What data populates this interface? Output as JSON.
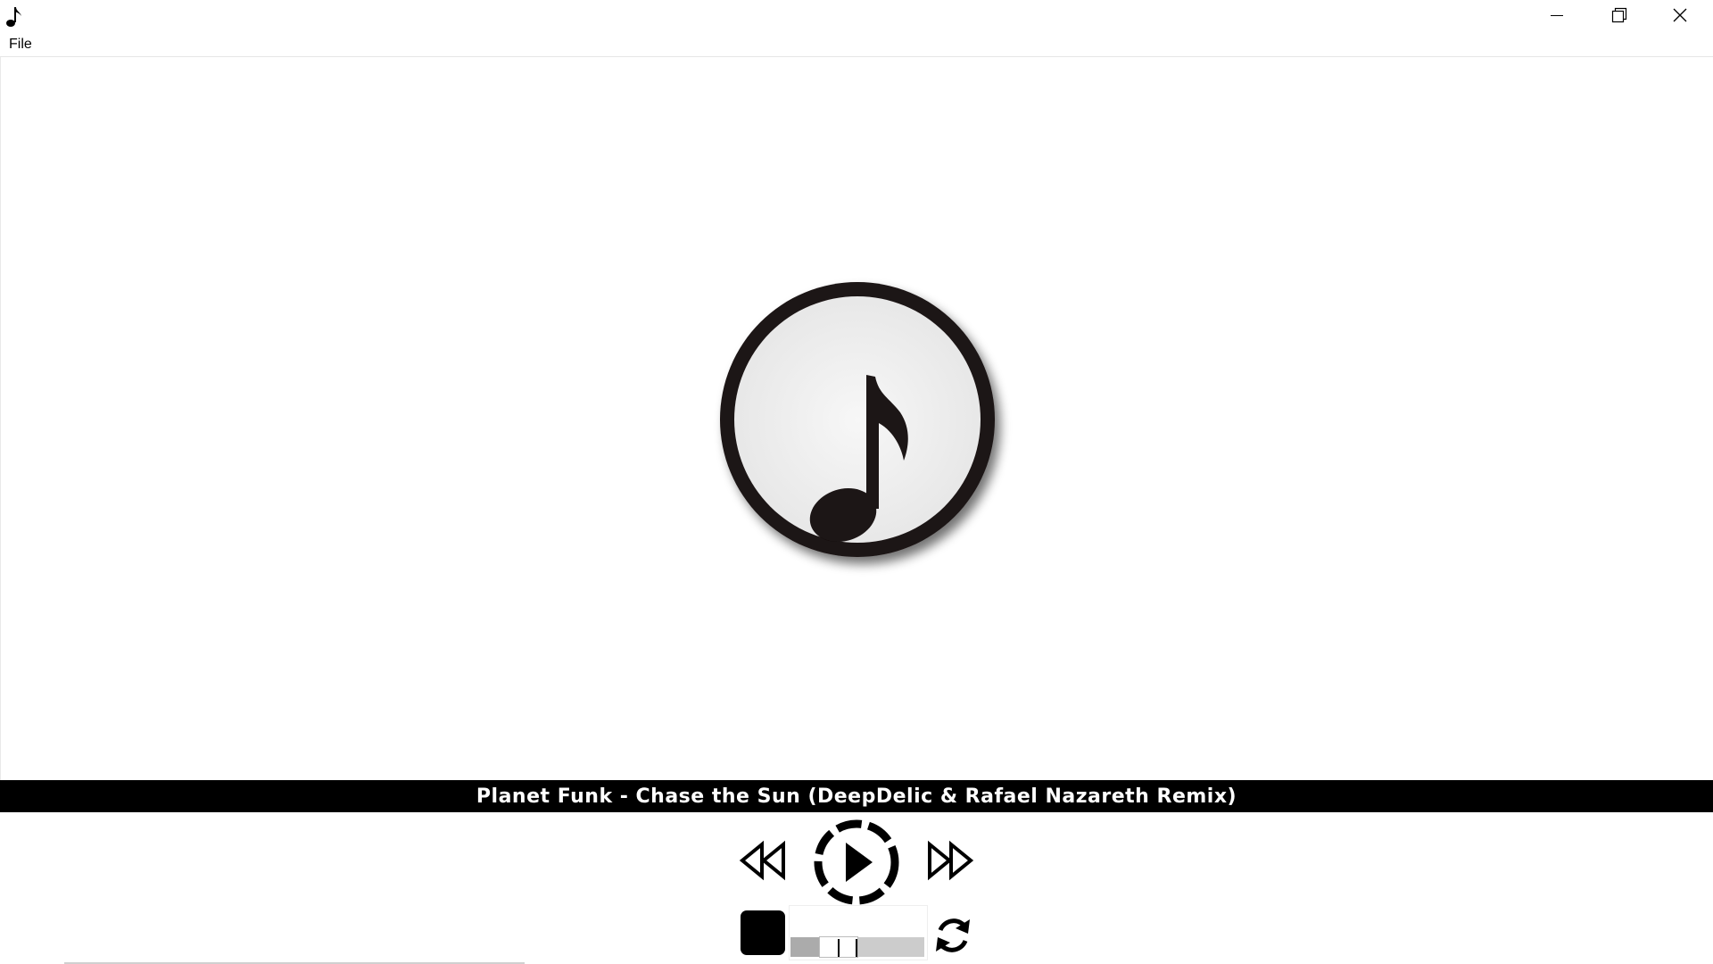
{
  "window": {
    "app_icon": "music-note-icon",
    "controls": {
      "minimize": "minimize-icon",
      "maximize": "restore-icon",
      "close": "close-icon"
    }
  },
  "menu": {
    "items": [
      {
        "label": "File"
      }
    ]
  },
  "artwork": {
    "icon": "music-note-circle-icon"
  },
  "player": {
    "track_title": "Planet Funk - Chase the Sun (DeepDelic & Rafael Nazareth Remix)",
    "buttons": {
      "rewind": "rewind-icon",
      "play": "play-icon",
      "forward": "fast-forward-icon",
      "stop": "stop-icon",
      "repeat": "repeat-icon"
    },
    "volume_level": 0.3
  },
  "colors": {
    "background": "#ffffff",
    "track_bar": "#000000",
    "track_text": "#ffffff",
    "slider_track": "#cccccc"
  }
}
